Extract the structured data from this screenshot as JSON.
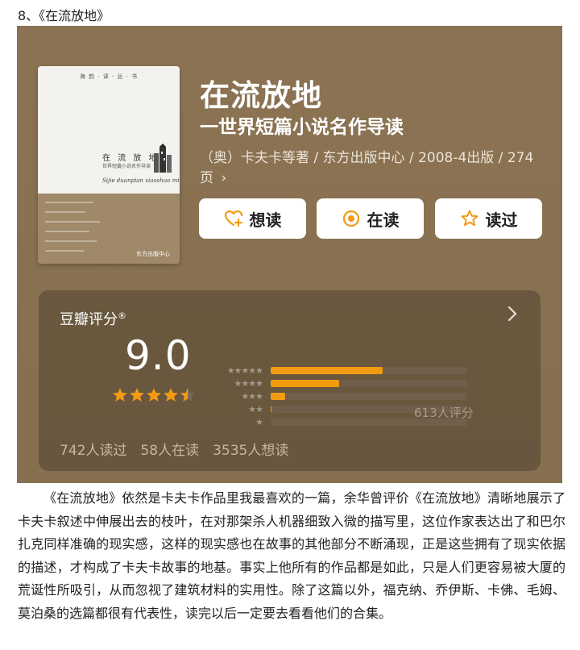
{
  "heading": "8、《在流放地》",
  "book": {
    "cover": {
      "series": "海 韵 · 译 · 丛 · 书",
      "title": "在 流 放 地",
      "subtitle": "世界短篇小说名作导读",
      "script": "Sijie duanpian xiaoshuo mingzuo daodu",
      "publisher": "东方出版中心"
    },
    "title": "在流放地",
    "subtitle": "一世界短篇小说名作导读",
    "meta": "（奥）卡夫卡等著 / 东方出版中心 / 2008-4出版 / 274页",
    "meta_chevron": "›"
  },
  "actions": {
    "want": "想读",
    "reading": "在读",
    "read": "读过"
  },
  "rating": {
    "label": "豆瓣评分",
    "label_mark": "®",
    "score": "9.0",
    "stars": 4.5,
    "distribution": [
      {
        "stars": "★★★★★",
        "fraction": 0.57
      },
      {
        "stars": "★★★★",
        "fraction": 0.35
      },
      {
        "stars": "★★★",
        "fraction": 0.075
      },
      {
        "stars": "★★",
        "fraction": 0.005
      },
      {
        "stars": "★",
        "fraction": 0.0
      }
    ],
    "count": "613人评分",
    "stats": {
      "read": "742人读过",
      "reading": "58人在读",
      "want": "3535人想读"
    }
  },
  "colors": {
    "panel": "#8b7253",
    "accent": "#f29b12",
    "button_bg": "#ffffff"
  },
  "paragraph": "《在流放地》依然是卡夫卡作品里我最喜欢的一篇，余华曾评价《在流放地》清晰地展示了卡夫卡叙述中伸展出去的枝叶，在对那架杀人机器细致入微的描写里，这位作家表达出了和巴尔扎克同样准确的现实感，这样的现实感也在故事的其他部分不断涌现，正是这些拥有了现实依据的描述，才构成了卡夫卡故事的地基。事实上他所有的作品都是如此，只是人们更容易被大厦的荒诞性所吸引，从而忽视了建筑材料的实用性。除了这篇以外，福克纳、乔伊斯、卡佛、毛姆、莫泊桑的选篇都很有代表性，读完以后一定要去看看他们的合集。"
}
